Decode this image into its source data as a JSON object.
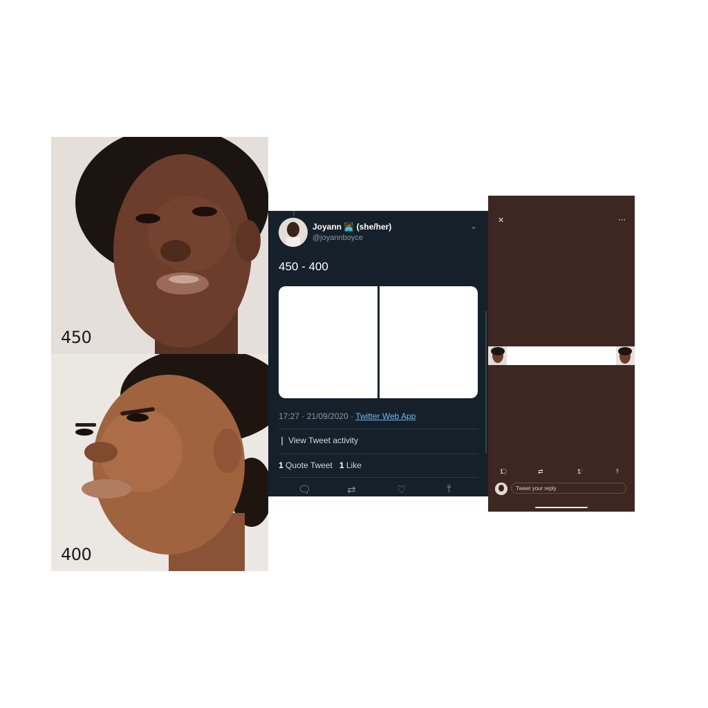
{
  "photos": {
    "top_label": "450",
    "bottom_label": "400"
  },
  "tweet": {
    "display_name": "Joyann 👩🏾‍💻 (she/her)",
    "handle": "@joyannboyce",
    "text": "450 - 400",
    "timestamp": "17:27 · 21/09/2020 · ",
    "source_link": "Twitter Web App",
    "activity_label": "View Tweet activity",
    "quote_count": "1",
    "quote_label": " Quote Tweet",
    "like_count": "1",
    "like_label": " Like",
    "icons": [
      "reply-icon",
      "retweet-icon",
      "like-icon",
      "share-icon"
    ]
  },
  "viewer": {
    "reply_count": "1",
    "like_count": "1",
    "reply_placeholder": "Tweet your reply"
  },
  "colors": {
    "tweet_bg": "#15202b",
    "viewer_bg": "#3e2722",
    "link": "#6fb7ee"
  }
}
